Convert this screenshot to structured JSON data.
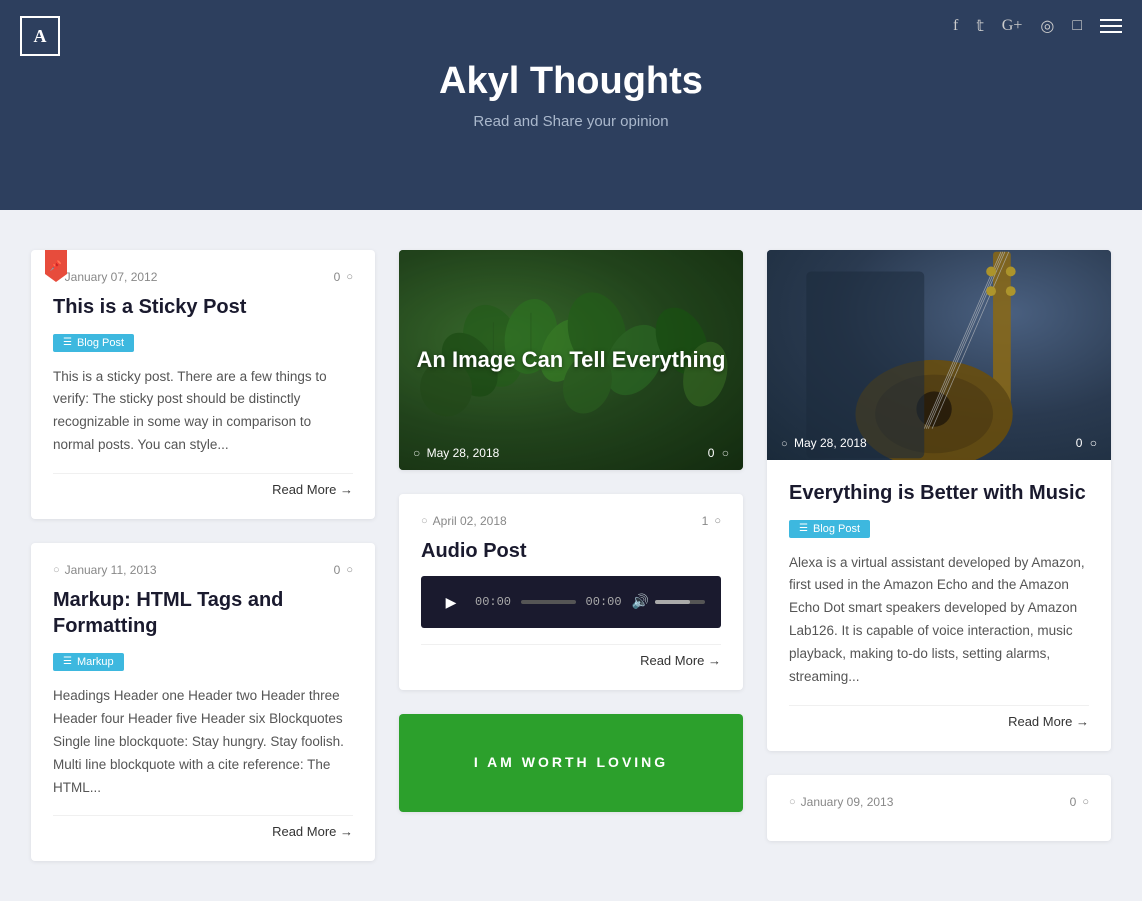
{
  "header": {
    "logo_text": "A",
    "title": "Akyl Thoughts",
    "subtitle": "Read and Share your opinion",
    "nav_icons": [
      "facebook",
      "twitter",
      "google-plus",
      "dribbble",
      "instagram",
      "menu"
    ]
  },
  "cards": {
    "sticky_post": {
      "date": "January 07, 2012",
      "comments": "0",
      "title": "This is a Sticky Post",
      "tag": "Blog Post",
      "excerpt": "This is a sticky post. There are a few things to verify: The sticky post should be distinctly recognizable in some way in comparison to normal posts. You can style...",
      "read_more": "Read More →"
    },
    "markup_post": {
      "date": "January 11, 2013",
      "comments": "0",
      "title": "Markup: HTML Tags and Formatting",
      "tag": "Markup",
      "excerpt": "Headings Header one Header two Header three Header four Header five Header six Blockquotes Single line blockquote: Stay hungry. Stay foolish. Multi line blockquote with a cite reference: The HTML...",
      "read_more": "Read More →"
    },
    "image_post": {
      "date": "May 28, 2018",
      "comments": "0",
      "title": "An Image Can Tell Everything",
      "bg_type": "leaves"
    },
    "audio_post": {
      "date": "April 02, 2018",
      "comments": "1",
      "title": "Audio Post",
      "time_current": "00:00",
      "time_total": "00:00",
      "read_more": "Read More →"
    },
    "green_post": {
      "title": "I AM WORTH LOVING"
    },
    "music_post": {
      "date": "May 28, 2018",
      "comments": "0",
      "title": "Everything is Better with Music",
      "tag": "Blog Post",
      "excerpt": "Alexa is a virtual assistant developed by Amazon, first used in the Amazon Echo and the Amazon Echo Dot smart speakers developed by Amazon Lab126. It is capable of voice interaction, music playback, making to-do lists, setting alarms, streaming...",
      "read_more": "Read More →",
      "bg_type": "guitar"
    },
    "bottom_post": {
      "date": "January 09, 2013",
      "comments": "0"
    }
  }
}
